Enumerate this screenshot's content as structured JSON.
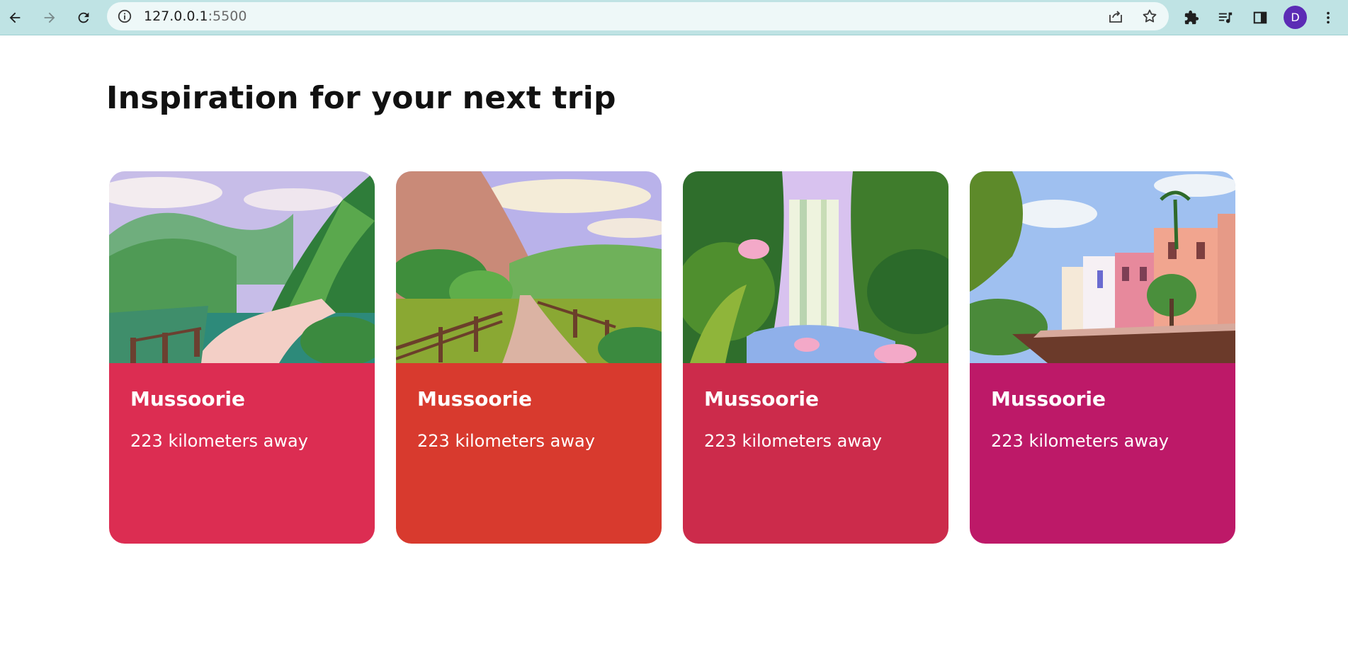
{
  "browser": {
    "url_host": "127.0.0.1",
    "url_port": ":5500",
    "avatar_letter": "D",
    "icons": [
      "back-arrow-icon",
      "forward-arrow-icon",
      "reload-icon",
      "info-icon",
      "share-icon",
      "star-icon",
      "extensions-icon",
      "media-icon",
      "side-panel-icon",
      "menu-icon"
    ]
  },
  "page": {
    "heading": "Inspiration for your next trip"
  },
  "cards": [
    {
      "title": "Mussoorie",
      "distance": "223 kilometers away",
      "color": "#dc2d52"
    },
    {
      "title": "Mussoorie",
      "distance": "223 kilometers away",
      "color": "#d83a2e"
    },
    {
      "title": "Mussoorie",
      "distance": "223 kilometers away",
      "color": "#cc2b4b"
    },
    {
      "title": "Mussoorie",
      "distance": "223 kilometers away",
      "color": "#bd1968"
    }
  ]
}
